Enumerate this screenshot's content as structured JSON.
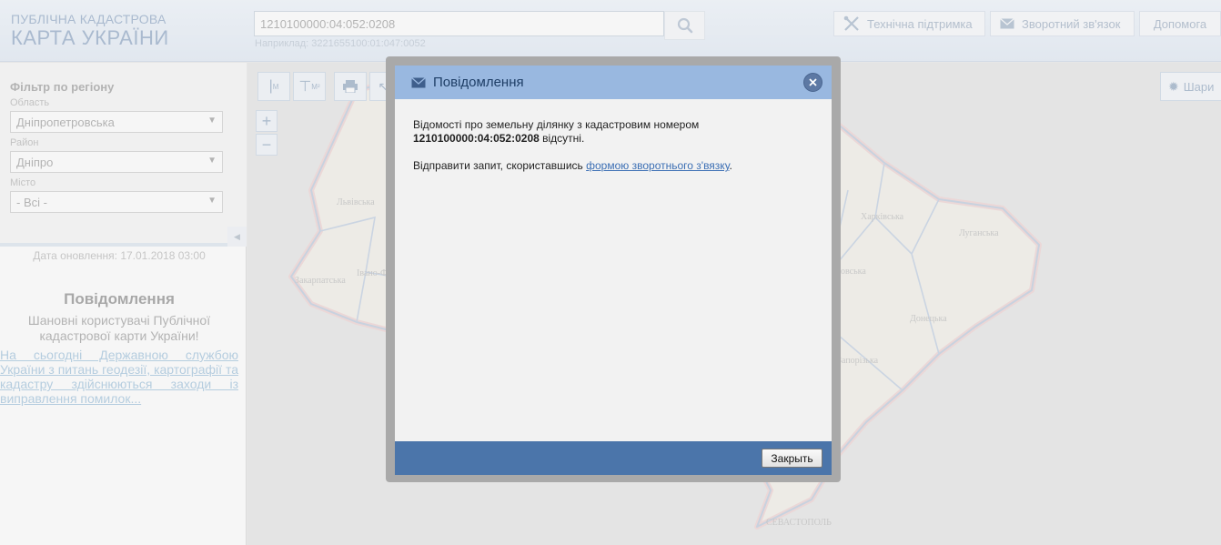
{
  "header": {
    "logo_line1": "ПУБЛІЧНА КАДАСТРОВА",
    "logo_line2": "КАРТА УКРАЇНИ",
    "search": {
      "value": "1210100000:04:052:0208",
      "hint": "Наприклад: 3221655100:01:047:0052"
    },
    "buttons": {
      "support": "Технічна підтримка",
      "feedback": "Зворотний зв'язок",
      "help": "Допомога"
    }
  },
  "sidebar": {
    "filter_title": "Фільтр по регіону",
    "oblast_label": "Область",
    "oblast_value": "Дніпропетровська",
    "raion_label": "Район",
    "raion_value": "Дніпро",
    "city_label": "Місто",
    "city_value": "- Всі -",
    "update_date": "Дата оновлення: 17.01.2018 03:00",
    "notice_title": "Повідомлення",
    "notice_text": "Шановні користувачі Публічної кадастрової карти України!",
    "notice_link": "На сьогодні Державною службою України з питань геодезії, картографії та кадастру здійснюються заходи із виправлення помилок..."
  },
  "map": {
    "toolbar": {
      "tool1": "M",
      "tool2": "M²",
      "tool4": "?"
    },
    "zoom_in": "+",
    "zoom_out": "−",
    "layers_label": "Шари",
    "labels": {
      "lviv": "Львівська",
      "zakarpat": "Закарпатська",
      "ivano": "Івано-Ф",
      "kharkiv": "Харківська",
      "luhansk": "Луганська",
      "donetsk": "Донецька",
      "zaporizh": "Запорізька",
      "dnipro": "овська",
      "sevastopol": "СЕВАСТОПОЛЬ"
    }
  },
  "modal": {
    "title": "Повідомлення",
    "text_part1": "Відомості про земельну ділянку з кадастровим номером",
    "cadastral_number": "1210100000:04:052:0208",
    "text_part2": "відсутні.",
    "request_text": "Відправити запит, скориставшись",
    "link_text": "формою зворотнього з'вязку",
    "close_label": "Закрыть"
  },
  "colors": {
    "modal_header": "#99b8e0",
    "modal_footer": "#4b75aa",
    "link": "#3c6fb4"
  }
}
